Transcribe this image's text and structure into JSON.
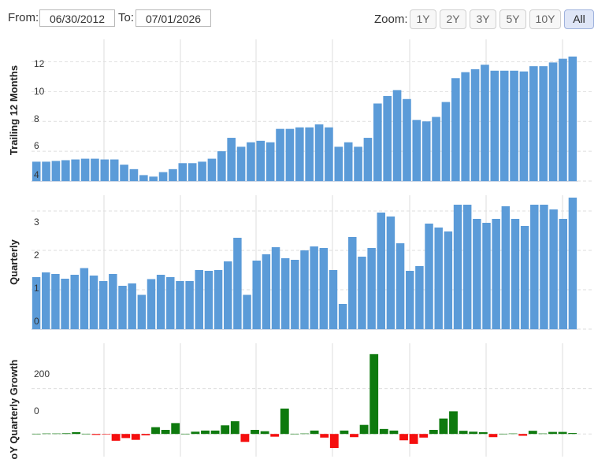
{
  "toolbar": {
    "from_label": "From:",
    "from_value": "06/30/2012",
    "to_label": "To:",
    "to_value": "07/01/2026",
    "zoom_label": "Zoom:",
    "zoom_buttons": [
      "1Y",
      "2Y",
      "3Y",
      "5Y",
      "10Y",
      "All"
    ],
    "zoom_active": "All"
  },
  "colors": {
    "bar_blue": "#5b9bd8",
    "growth_positive": "#0e7a0e",
    "growth_negative": "#f50f0f",
    "grid": "#dedede"
  },
  "chart_data": [
    {
      "type": "bar",
      "ylabel": "Trailing 12 Months",
      "yticks": [
        "4",
        "6",
        "8",
        "10",
        "12"
      ],
      "ylim": [
        4,
        13.5
      ],
      "grid": true,
      "values": [
        5.3,
        5.3,
        5.35,
        5.4,
        5.45,
        5.5,
        5.5,
        5.45,
        5.45,
        5.1,
        4.8,
        4.4,
        4.3,
        4.6,
        4.8,
        5.2,
        5.2,
        5.3,
        5.5,
        6.0,
        6.9,
        6.3,
        6.6,
        6.7,
        6.6,
        7.5,
        7.5,
        7.6,
        7.6,
        7.8,
        7.6,
        6.3,
        6.6,
        6.3,
        6.9,
        9.2,
        9.7,
        10.1,
        9.5,
        8.1,
        8.0,
        8.3,
        9.3,
        10.9,
        11.3,
        11.5,
        11.8,
        11.4,
        11.4,
        11.4,
        11.35,
        11.7,
        11.7,
        11.95,
        12.2,
        12.35
      ]
    },
    {
      "type": "bar",
      "ylabel": "Quarterly",
      "yticks": [
        "0",
        "1",
        "2",
        "3"
      ],
      "ylim": [
        0,
        3.4
      ],
      "grid": true,
      "values": [
        1.32,
        1.44,
        1.4,
        1.28,
        1.38,
        1.55,
        1.36,
        1.22,
        1.4,
        1.1,
        1.16,
        0.87,
        1.27,
        1.38,
        1.32,
        1.22,
        1.22,
        1.5,
        1.48,
        1.5,
        1.72,
        2.32,
        0.87,
        1.74,
        1.9,
        2.08,
        1.8,
        1.76,
        2.0,
        2.1,
        2.06,
        1.5,
        0.64,
        2.34,
        1.84,
        2.06,
        2.96,
        2.86,
        2.18,
        1.48,
        1.6,
        2.68,
        2.58,
        2.48,
        3.16,
        3.16,
        2.8,
        2.7,
        2.8,
        3.12,
        2.8,
        2.62,
        3.16,
        3.16,
        3.04,
        2.8,
        3.34
      ]
    },
    {
      "type": "bar",
      "ylabel": "YoY Quarterly Growth",
      "yticks": [
        "0",
        "200"
      ],
      "ylim": [
        -100,
        400
      ],
      "grid": true,
      "values": [
        1,
        2,
        2,
        3,
        8,
        1,
        -4,
        -2,
        -30,
        -18,
        -26,
        -6,
        30,
        18,
        48,
        1,
        10,
        15,
        15,
        38,
        56,
        -35,
        18,
        12,
        -12,
        112,
        1,
        2,
        15,
        -16,
        -62,
        15,
        -14,
        40,
        352,
        22,
        15,
        -28,
        -44,
        -16,
        18,
        68,
        100,
        14,
        10,
        8,
        -14,
        1,
        2,
        -8,
        14,
        2,
        9,
        9,
        4
      ]
    }
  ]
}
